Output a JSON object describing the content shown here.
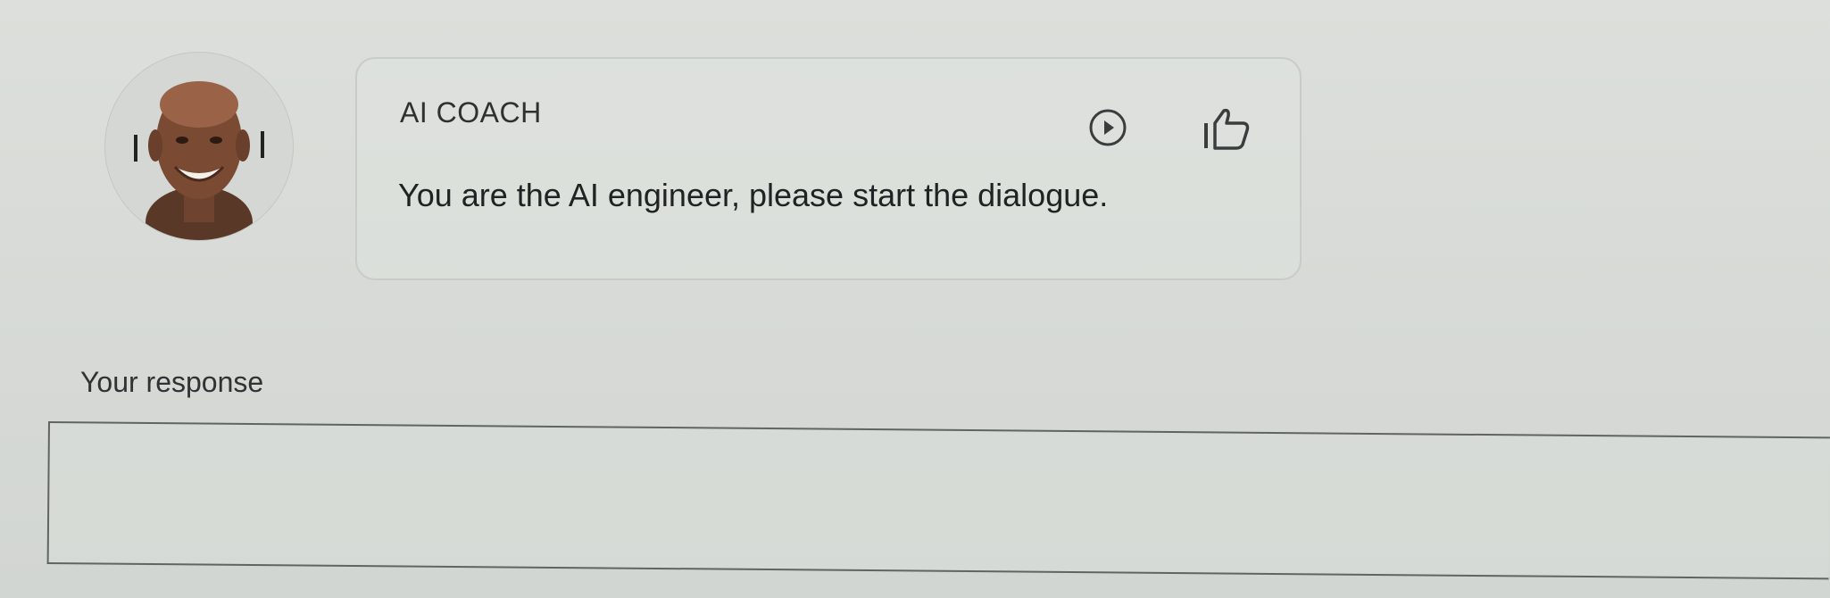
{
  "coach": {
    "name": "AI COACH",
    "message": "You are the AI engineer, please start the dialogue.",
    "avatar_icon": "coach-avatar",
    "play_icon": "play-icon",
    "like_icon": "thumbs-up-icon"
  },
  "response": {
    "label": "Your response",
    "value": "",
    "placeholder": ""
  },
  "colors": {
    "background": "#d9dcd8",
    "text": "#2b2e2e",
    "card_border": "#c8ccc8",
    "input_border": "#5f6464"
  }
}
